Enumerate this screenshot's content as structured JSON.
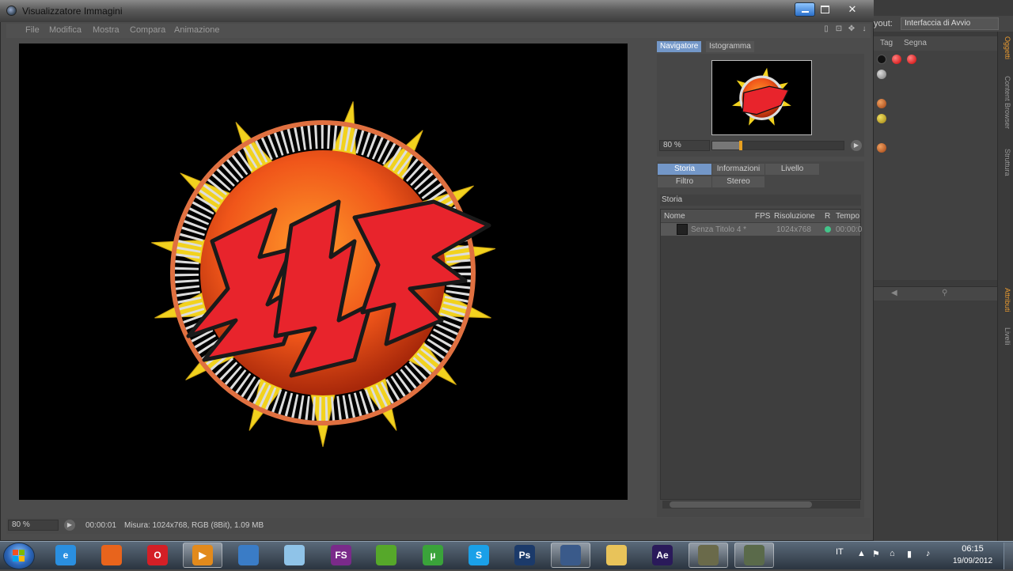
{
  "background_app": {
    "layout_label": "yout:",
    "layout_value": "Interfaccia di Avvio",
    "objects_tabs": [
      "Tag",
      "Segna"
    ],
    "side_tabs": [
      "Oggetti",
      "Content Browser",
      "Struttura",
      "Attributi",
      "Livelli"
    ]
  },
  "viewer": {
    "title": "Visualizzatore Immagini",
    "menu": [
      "File",
      "Modifica",
      "Mostra",
      "Compara",
      "Animazione"
    ],
    "close_label": "✕"
  },
  "navigator": {
    "tabs": [
      "Navigatore",
      "Istogramma"
    ],
    "active_tab": "Navigatore",
    "zoom": "80 %",
    "zoom_slider_percent": 22
  },
  "history": {
    "tabs_row1": [
      "Storia",
      "Informazioni",
      "Livello"
    ],
    "tabs_row2": [
      "Filtro",
      "Stereo"
    ],
    "active_tab": "Storia",
    "section_title": "Storia",
    "columns": [
      "Nome",
      "FPS",
      "Risoluzione",
      "R",
      "Tempo"
    ],
    "rows": [
      {
        "name": "Senza Titolo 4 *",
        "fps": "",
        "resolution": "1024x768",
        "time": "00:00:0"
      }
    ]
  },
  "statusbar": {
    "zoom": "80 %",
    "time": "00:00:01",
    "info": "Misura: 1024x768, RGB (8Bit), 1.09 MB"
  },
  "taskbar": {
    "apps": [
      {
        "name": "internet-explorer",
        "glyph": "e",
        "color": "#2a8fe0"
      },
      {
        "name": "firefox",
        "glyph": "",
        "color": "#e8641c"
      },
      {
        "name": "opera",
        "glyph": "O",
        "color": "#d41f26"
      },
      {
        "name": "media-player",
        "glyph": "▶",
        "color": "#e28a1c"
      },
      {
        "name": "windows-explorer-folder",
        "glyph": "",
        "color": "#3a7cc6"
      },
      {
        "name": "notepad",
        "glyph": "",
        "color": "#8fc3e8"
      },
      {
        "name": "fs-app",
        "glyph": "FS",
        "color": "#7a2a8a"
      },
      {
        "name": "parrot-app",
        "glyph": "",
        "color": "#56a82a"
      },
      {
        "name": "utorrent",
        "glyph": "µ",
        "color": "#3aa33a"
      },
      {
        "name": "skype",
        "glyph": "S",
        "color": "#1aa0e8"
      },
      {
        "name": "photoshop",
        "glyph": "Ps",
        "color": "#1b3a6a"
      },
      {
        "name": "cinema4d",
        "glyph": "",
        "color": "#3a5a8a"
      },
      {
        "name": "file-manager",
        "glyph": "",
        "color": "#e8c35a"
      },
      {
        "name": "after-effects",
        "glyph": "Ae",
        "color": "#2a1a5a"
      },
      {
        "name": "render-app-1",
        "glyph": "",
        "color": "#6a6a4a"
      },
      {
        "name": "render-app-2",
        "glyph": "",
        "color": "#5a6a4a"
      }
    ],
    "tray_lang": "IT",
    "time": "06:15",
    "date": "19/09/2012"
  }
}
